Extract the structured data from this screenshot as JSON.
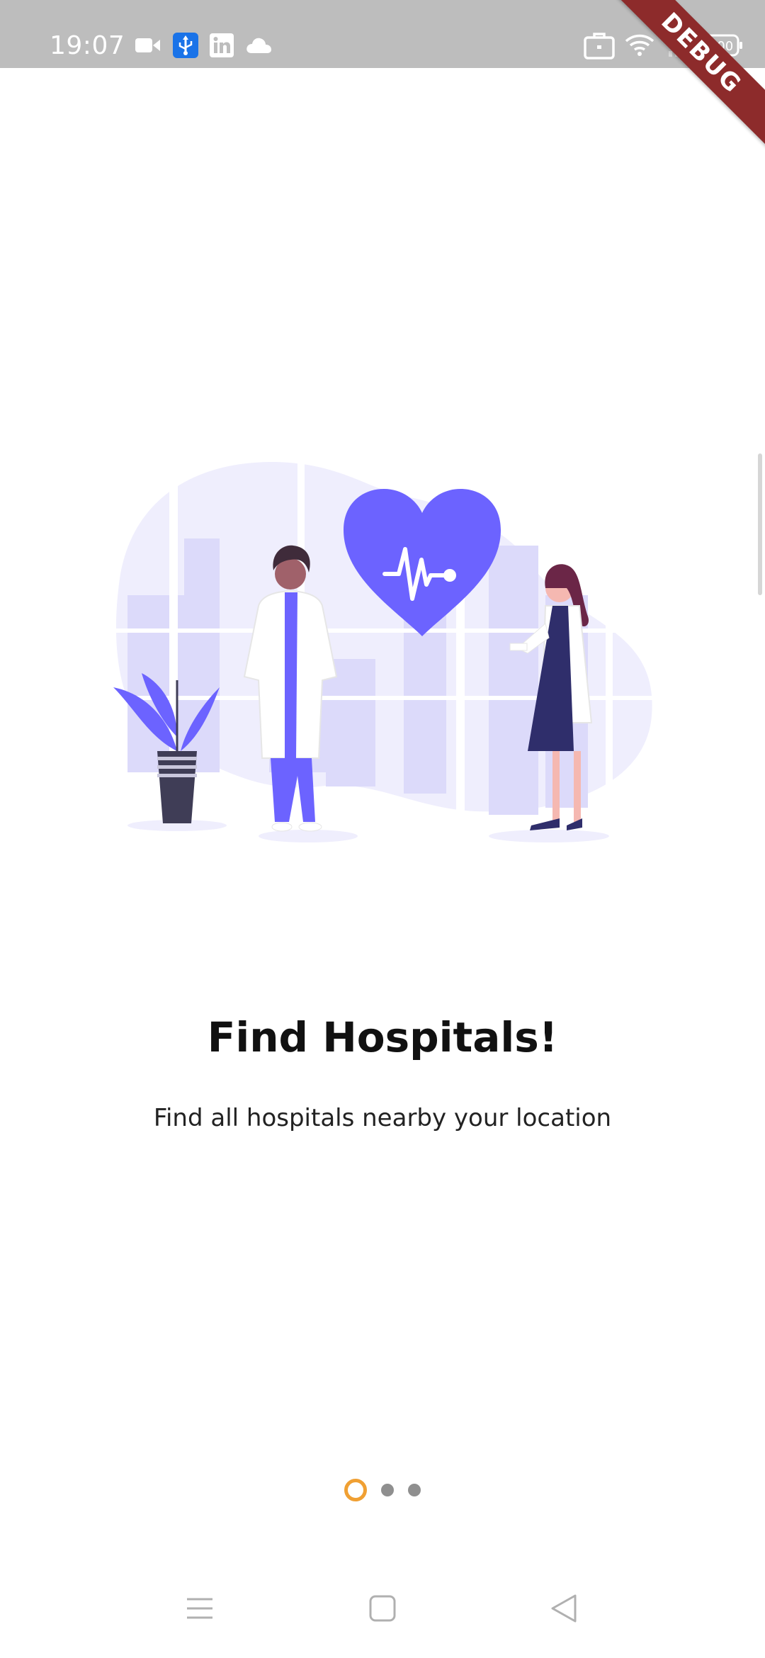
{
  "status_bar": {
    "time": "19:07",
    "battery_level": "100",
    "left_icons": [
      "video-icon",
      "usb-icon",
      "linkedin-icon",
      "cloud-icon"
    ],
    "right_icons": [
      "briefcase-icon",
      "wifi-icon",
      "signal-icon",
      "battery-icon"
    ]
  },
  "debug_banner": {
    "label": "DEBUG",
    "color": "#8d2b2b"
  },
  "onboarding": {
    "illustration": "doctors-heart-illustration",
    "title": "Find Hospitals!",
    "subtitle": "Find all hospitals nearby your location",
    "accent_color": "#6c63ff"
  },
  "page_indicator": {
    "total": 3,
    "current": 1,
    "active_color": "#f0a033",
    "inactive_color": "#8f8f8f"
  },
  "nav_bar": {
    "buttons": [
      "menu-icon",
      "home-icon",
      "back-icon"
    ]
  }
}
